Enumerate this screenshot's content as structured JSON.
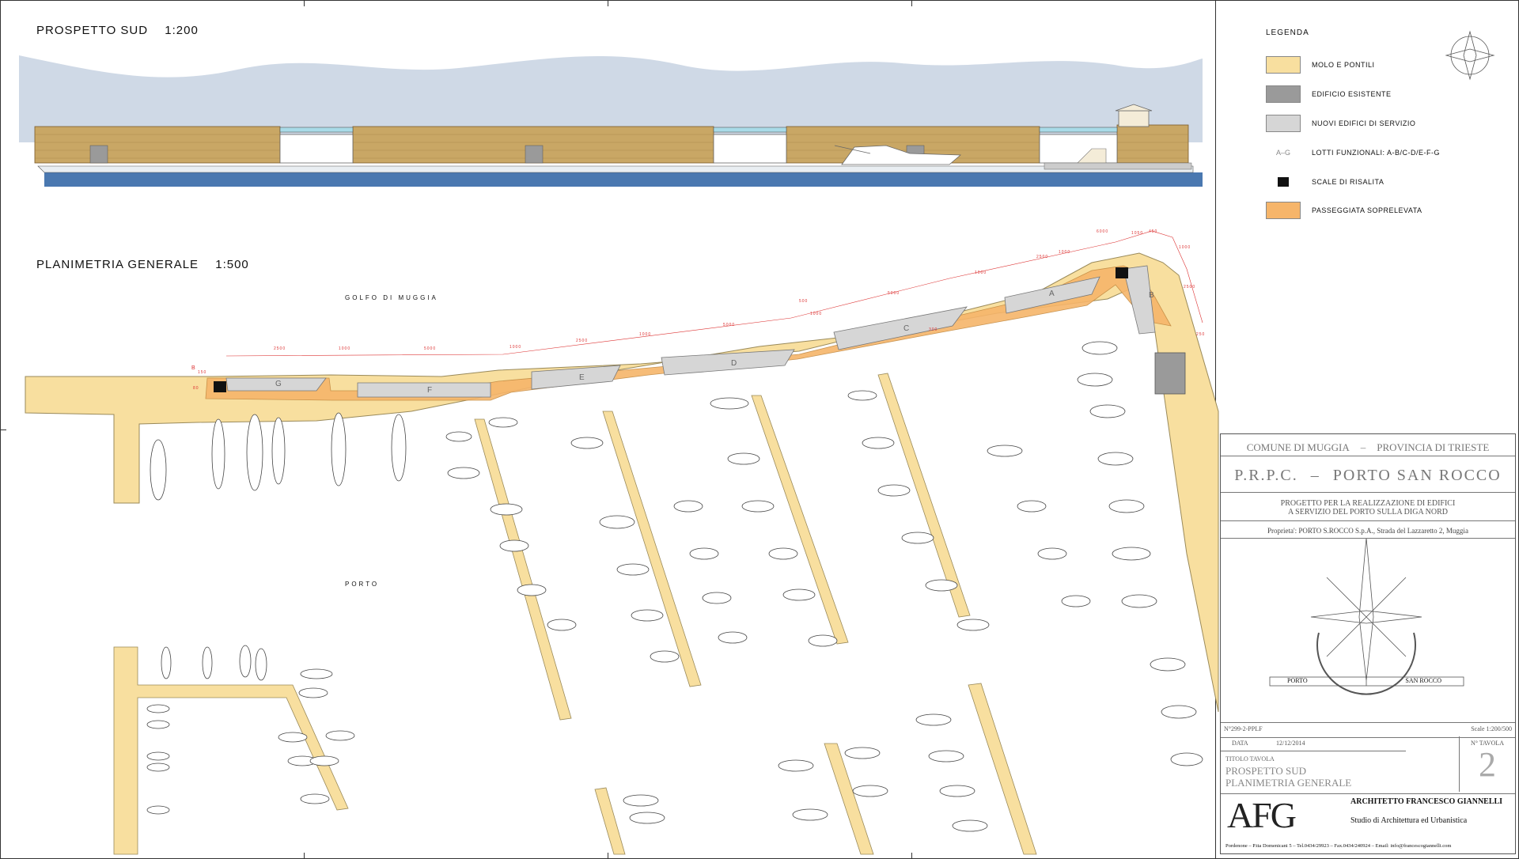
{
  "elevation": {
    "title": "PROSPETTO SUD",
    "scale": "1:200"
  },
  "plan": {
    "title": "PLANIMETRIA GENERALE",
    "scale": "1:500",
    "gulf_label": "GOLFO DI MUGGIA",
    "port_label": "PORTO",
    "lots": [
      "A",
      "B",
      "C",
      "D",
      "E",
      "F",
      "G"
    ],
    "dimensions": [
      "2500",
      "1000",
      "5000",
      "1000",
      "2500",
      "1000",
      "5000",
      "1000",
      "5000",
      "1000",
      "2500",
      "1000",
      "6000",
      "1050",
      "450",
      "1000",
      "2500",
      "250",
      "300",
      "500",
      "150",
      "80",
      "B"
    ]
  },
  "legend": {
    "title": "LEGENDA",
    "items": [
      {
        "label": "MOLO E PONTILI",
        "color": "#f8df9f",
        "type": "swatch"
      },
      {
        "label": "EDIFICIO ESISTENTE",
        "color": "#9a9a9a",
        "type": "swatch"
      },
      {
        "label": "NUOVI EDIFICI DI SERVIZIO",
        "color": "#d6d6d6",
        "type": "swatch"
      },
      {
        "label": "LOTTI FUNZIONALI: A-B/C-D/E-F-G",
        "symbol": "A–G",
        "type": "text"
      },
      {
        "label": "SCALE DI RISALITA",
        "type": "stair"
      },
      {
        "label": "PASSEGGIATA SOPRELEVATA",
        "color": "#f6b56a",
        "type": "swatch"
      }
    ]
  },
  "title_block": {
    "comune": "COMUNE DI MUGGIA",
    "dash": "–",
    "provincia": "PROVINCIA DI TRIESTE",
    "project_code": "P.R.P.C.",
    "project_name": "PORTO SAN ROCCO",
    "desc_line1": "PROGETTO PER LA REALIZZAZIONE DI EDIFICI",
    "desc_line2": "A SERVIZIO DEL PORTO SULLA DIGA NORD",
    "owner": "Proprieta': PORTO S.ROCCO S.p.A., Strada del Lazzaretto 2, Muggia",
    "logo_left": "PORTO",
    "logo_right": "SAN ROCCO",
    "doc_number": "N°299-2-PPLF",
    "scale_label": "Scale 1:200/500",
    "date_label": "DATA",
    "date_value": "12/12/2014",
    "tavola_label": "N° TAVOLA",
    "tavola_number": "2",
    "titolo_label": "TITOLO TAVOLA",
    "titolo_line1": "PROSPETTO SUD",
    "titolo_line2": "PLANIMETRIA GENERALE",
    "firm_logo": "AFG",
    "architect": "ARCHITETTO FRANCESCO GIANNELLI",
    "studio": "Studio di Architettura ed Urbanistica",
    "address": "Pordenone – P.tta Domenicani 5 – Tel.0434/29923 – Fax.0434/240924 – Email: info@francescogiannelli.com"
  },
  "colors": {
    "pier": "#f8df9f",
    "promenade": "#f6b56a",
    "existing": "#9a9a9a",
    "new_building": "#d6d6d6",
    "sky": "#cfd9e6",
    "water": "#4a78b0",
    "wall": "#c9a765",
    "dimension": "#d33"
  }
}
